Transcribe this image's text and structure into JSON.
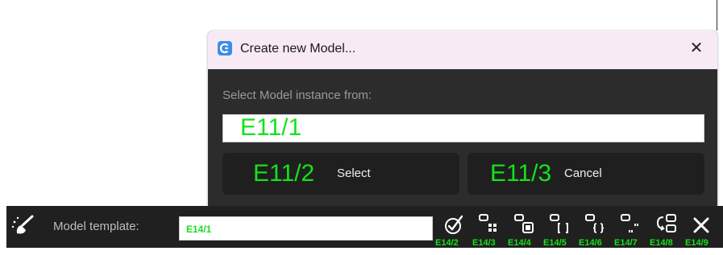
{
  "dialog": {
    "title": "Create new Model...",
    "close_glyph": "✕",
    "prompt": "Select Model instance from:",
    "input_tag": "E11/1",
    "select_tag": "E11/2",
    "select_label": "Select",
    "cancel_tag": "E11/3",
    "cancel_label": "Cancel"
  },
  "toolbar": {
    "template_label": "Model template:",
    "template_tag": "E14/1",
    "tags": [
      "E14/2",
      "E14/3",
      "E14/4",
      "E14/5",
      "E14/6",
      "E14/7",
      "E14/8",
      "E14/9"
    ],
    "icons": [
      "brush-icon",
      "check-circle-icon",
      "grid-object-icon",
      "list-object-icon",
      "array-object-icon",
      "dict-object-icon",
      "string-object-icon",
      "swap-object-icon",
      "close-icon"
    ]
  },
  "colors": {
    "overlay_green": "#13e21b",
    "dialog_bg": "#2c2c2c",
    "titlebar_bg": "#f8eaf5",
    "toolbar_bg": "#202020"
  }
}
